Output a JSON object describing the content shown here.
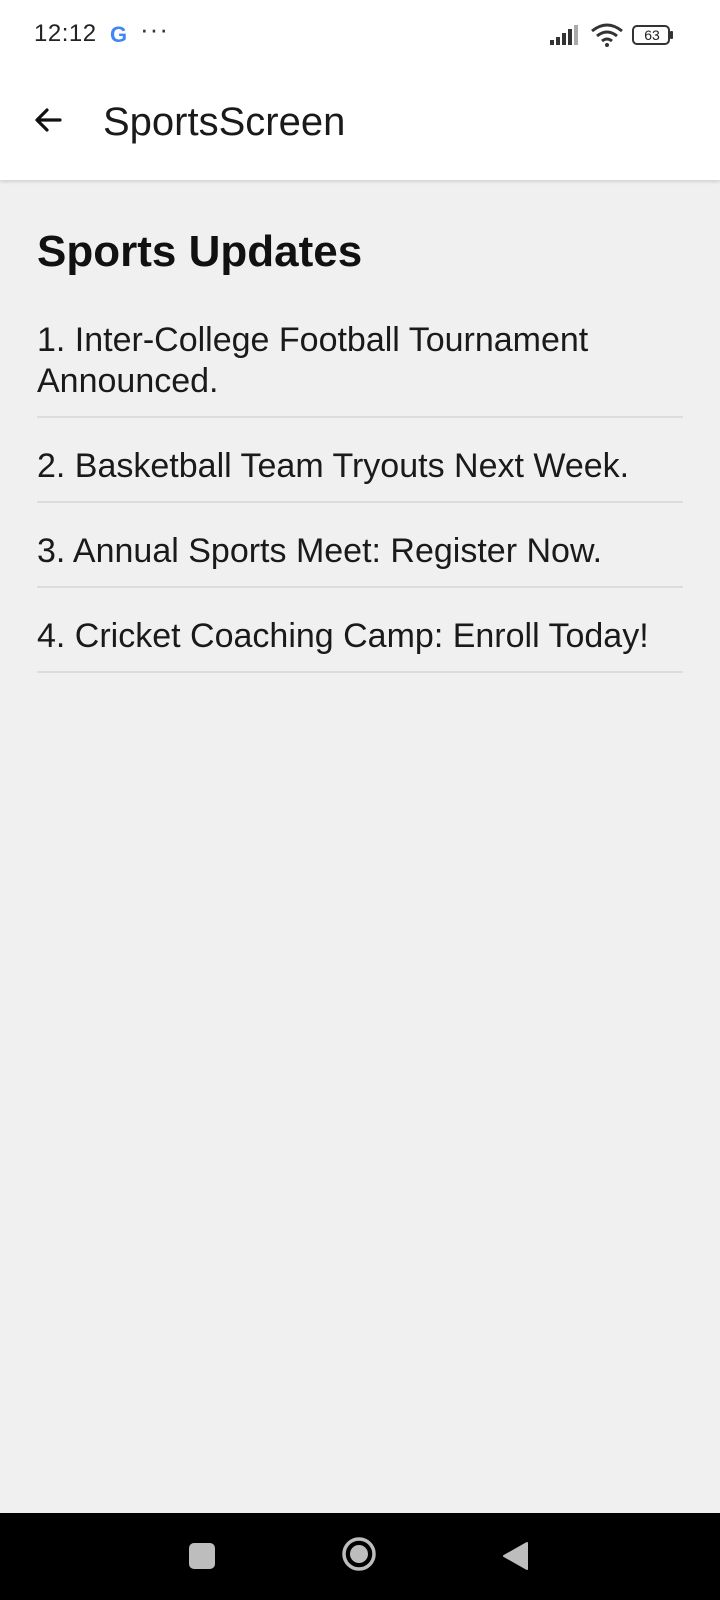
{
  "status_bar": {
    "time": "12:12",
    "google_label": "G",
    "more": "···",
    "battery": "63"
  },
  "app_bar": {
    "title": "SportsScreen",
    "back_icon": "arrow-left-icon"
  },
  "main": {
    "heading": "Sports Updates",
    "items": [
      {
        "text": "1. Inter-College Football Tournament Announced."
      },
      {
        "text": "2. Basketball Team Tryouts Next Week."
      },
      {
        "text": "3. Annual Sports Meet: Register Now."
      },
      {
        "text": "4. Cricket Coaching Camp: Enroll Today!"
      }
    ]
  },
  "colors": {
    "background": "#f0f0f0",
    "app_bar": "#ffffff",
    "divider": "#dcdcdc",
    "nav_bar": "#000000"
  }
}
